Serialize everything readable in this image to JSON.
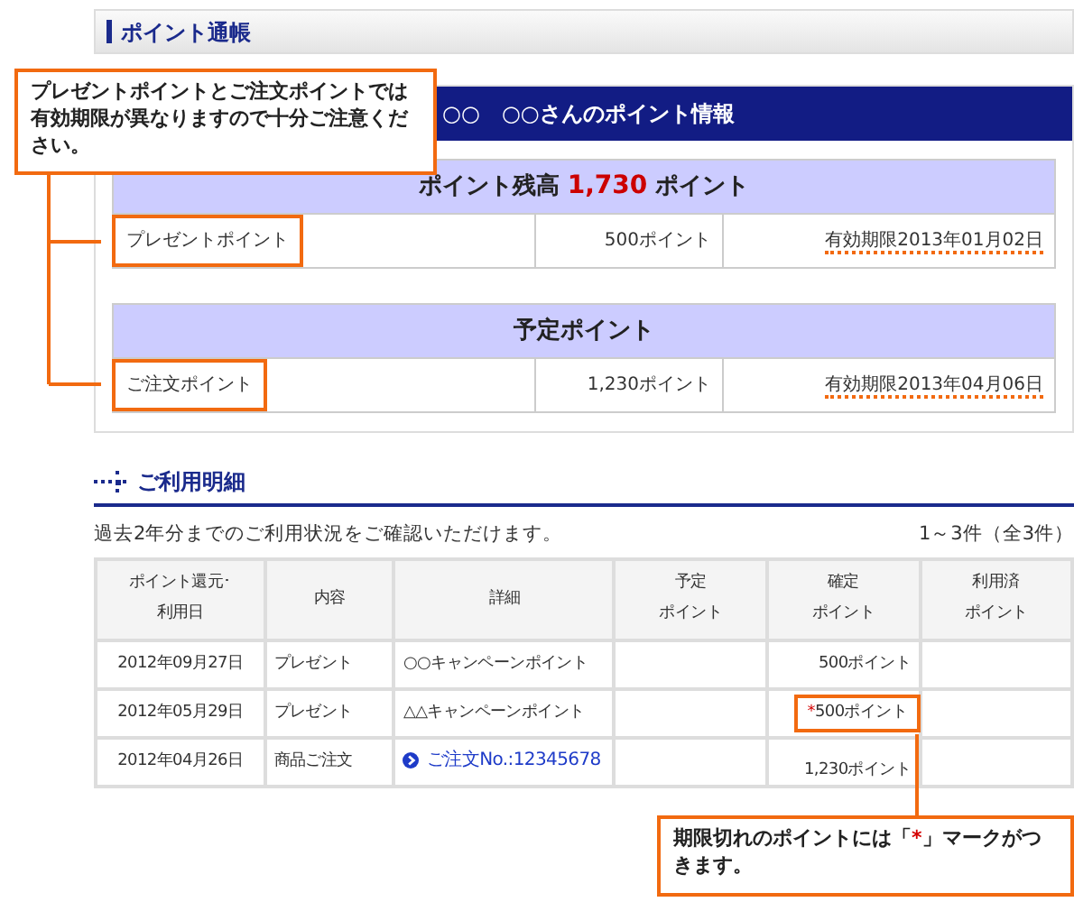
{
  "page_title": "ポイント通帳",
  "points_info": {
    "heading": "○○　○○さんのポイント情報",
    "balance": {
      "label": "ポイント残高",
      "amount": "1,730",
      "unit": "ポイント"
    },
    "balance_rows": [
      {
        "name": "プレゼントポイント",
        "highlighted": true,
        "points": "500ポイント",
        "expiry": "有効期限2013年01月02日"
      }
    ],
    "scheduled": {
      "heading": "予定ポイント",
      "rows": [
        {
          "name": "ご注文ポイント",
          "highlighted": true,
          "points": "1,230ポイント",
          "expiry": "有効期限2013年04月06日"
        }
      ]
    }
  },
  "usage": {
    "heading": "ご利用明細",
    "description": "過去2年分までのご利用状況をご確認いただけます。",
    "count": "1～3件（全3件）",
    "columns": [
      {
        "lines": [
          "ポイント還元･",
          "利用日"
        ]
      },
      {
        "lines": [
          "内容"
        ]
      },
      {
        "lines": [
          "詳細"
        ]
      },
      {
        "lines": [
          "予定",
          "ポイント"
        ]
      },
      {
        "lines": [
          "確定",
          "ポイント"
        ]
      },
      {
        "lines": [
          "利用済",
          "ポイント"
        ]
      }
    ],
    "rows": [
      {
        "date": "2012年09月27日",
        "content": "プレゼント",
        "detail": {
          "text": "○○キャンペーンポイント",
          "link": false
        },
        "confirmed": {
          "text": "500ポイント",
          "highlighted": false
        }
      },
      {
        "date": "2012年05月29日",
        "content": "プレゼント",
        "detail": {
          "text": "△△キャンペーンポイント",
          "link": false
        },
        "confirmed": {
          "mark": "*",
          "text": "500ポイント",
          "highlighted": true
        }
      },
      {
        "date": "2012年04月26日",
        "content": "商品ご注文",
        "detail": {
          "text": "ご注文No.:12345678",
          "link": true
        },
        "confirmed": {
          "text": "1,230ポイント",
          "highlighted": false
        }
      }
    ]
  },
  "callouts": [
    {
      "segments": [
        {
          "kind": "plain",
          "text": "プレゼントポイントとご注文ポイントでは有効期限が異なりますので十分ご注意ください。"
        }
      ]
    },
    {
      "segments": [
        {
          "kind": "plain",
          "text": "期限切れのポイントには「"
        },
        {
          "kind": "mark",
          "text": "*"
        },
        {
          "kind": "plain",
          "text": "」マークがつきます。"
        }
      ]
    }
  ]
}
